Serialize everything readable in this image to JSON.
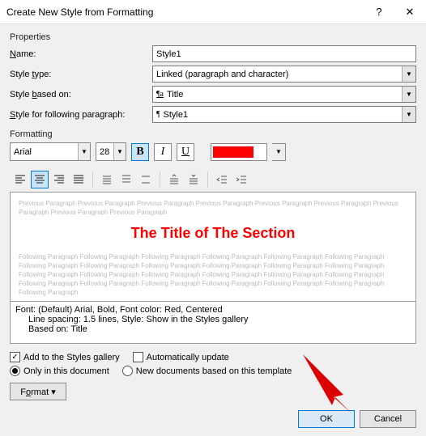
{
  "title": "Create New Style from Formatting",
  "properties_label": "Properties",
  "formatting_label": "Formatting",
  "props": {
    "name_label": "Name:",
    "name_value": "Style1",
    "type_label": "Style type:",
    "type_value": "Linked (paragraph and character)",
    "based_label": "Style based on:",
    "based_value": "Title",
    "following_label": "Style for following paragraph:",
    "following_value": "Style1"
  },
  "toolbar": {
    "font": "Arial",
    "size": "28",
    "bold": "B",
    "italic": "I",
    "underline": "U"
  },
  "preview": {
    "before": "Previous Paragraph Previous Paragraph Previous Paragraph Previous Paragraph Previous Paragraph Previous Paragraph Previous Paragraph Previous Paragraph Previous Paragraph",
    "title": "The Title of The Section",
    "after": "Following Paragraph Following Paragraph Following Paragraph Following Paragraph Following Paragraph Following Paragraph Following Paragraph Following Paragraph Following Paragraph Following Paragraph Following Paragraph Following Paragraph Following Paragraph Following Paragraph Following Paragraph Following Paragraph Following Paragraph Following Paragraph Following Paragraph Following Paragraph Following Paragraph Following Paragraph Following Paragraph Following Paragraph Following Paragraph"
  },
  "summary": {
    "line1": "Font: (Default) Arial, Bold, Font color: Red, Centered",
    "line2": "Line spacing:  1.5 lines, Style: Show in the Styles gallery",
    "line3": "Based on: Title"
  },
  "checks": {
    "add_gallery": "Add to the Styles gallery",
    "auto_update": "Automatically update",
    "only_doc": "Only in this document",
    "new_docs": "New documents based on this template"
  },
  "buttons": {
    "format": "Format ▾",
    "ok": "OK",
    "cancel": "Cancel"
  }
}
